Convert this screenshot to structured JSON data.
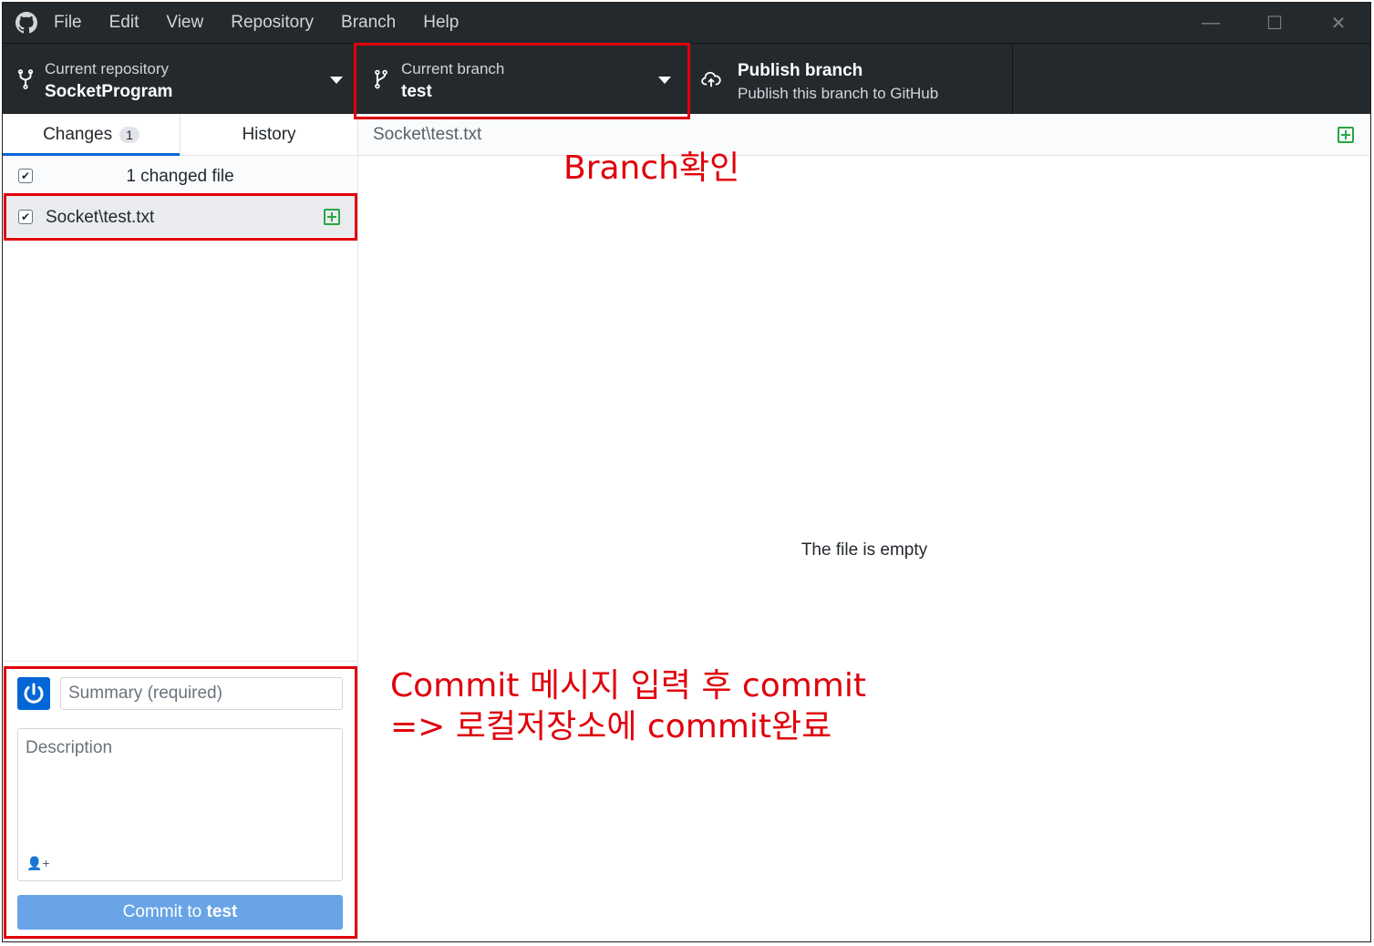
{
  "menu": [
    "File",
    "Edit",
    "View",
    "Repository",
    "Branch",
    "Help"
  ],
  "window_controls": {
    "minimize": "—",
    "maximize": "☐",
    "close": "✕"
  },
  "repo": {
    "label": "Current repository",
    "name": "SocketProgram"
  },
  "branch": {
    "label": "Current branch",
    "name": "test"
  },
  "publish": {
    "title": "Publish branch",
    "subtitle": "Publish this branch to GitHub"
  },
  "tabs": {
    "changes": "Changes",
    "changes_count": "1",
    "history": "History"
  },
  "changes": {
    "header": "1 changed file",
    "files": [
      {
        "name": "Socket\\test.txt",
        "status": "added"
      }
    ]
  },
  "diff": {
    "path": "Socket\\test.txt",
    "message": "The file is empty"
  },
  "commit": {
    "summary_placeholder": "Summary (required)",
    "description_placeholder": "Description",
    "coauthor_icon": "person-add-icon",
    "button_prefix": "Commit to ",
    "button_branch": "test"
  },
  "annotations": {
    "branch_note": "Branch확인",
    "commit_note_line1": "Commit 메시지 입력 후 commit",
    "commit_note_line2": "=> 로컬저장소에 commit완료"
  },
  "colors": {
    "titlebar": "#24292e",
    "accent": "#0366d6",
    "added": "#28a745",
    "commit_button": "#68a4e6",
    "annotation": "#e0000a"
  }
}
